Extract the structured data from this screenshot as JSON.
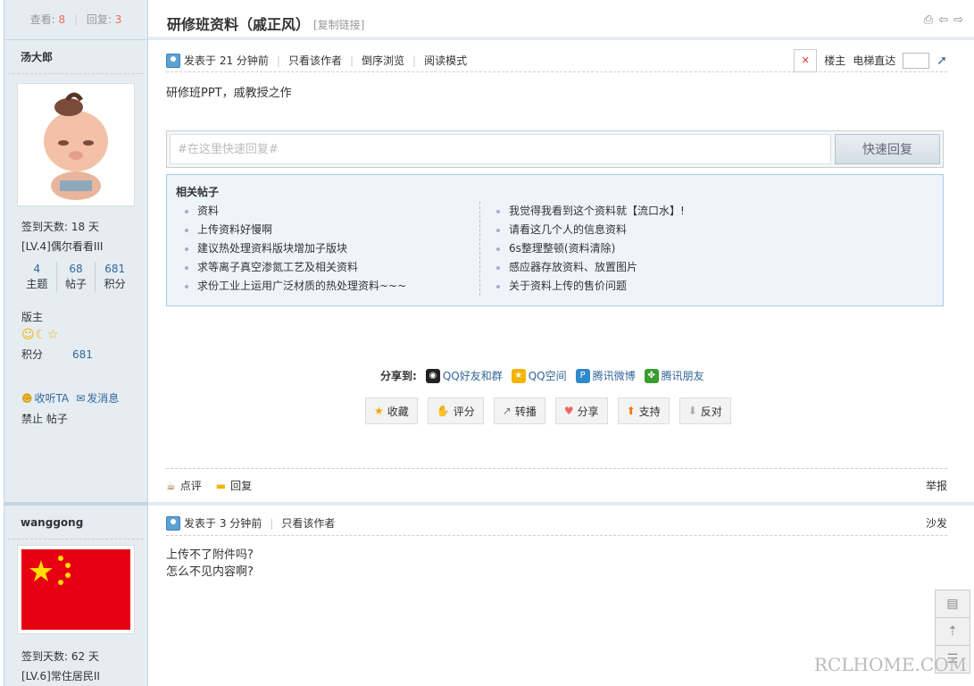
{
  "header": {
    "views_label": "查看:",
    "views_value": "8",
    "replies_label": "回复:",
    "replies_value": "3",
    "title": "研修班资料（戚正风）",
    "copy_link": "[复制链接]"
  },
  "post1": {
    "author": "汤大郎",
    "checkin": "签到天数: 18 天",
    "level": "[LV.4]偶尔看看III",
    "stats": [
      {
        "value": "4",
        "label": "主题"
      },
      {
        "value": "68",
        "label": "帖子"
      },
      {
        "value": "681",
        "label": "积分"
      }
    ],
    "role": "版主",
    "score_label": "积分",
    "score_value": "681",
    "follow": "收听TA",
    "message": "发消息",
    "ban": "禁止 帖子",
    "posted": "发表于 21 分钟前",
    "only_author": "只看该作者",
    "reverse": "倒序浏览",
    "read_mode": "阅读模式",
    "floor": "楼主",
    "elevator": "电梯直达",
    "body": "研修班PPT，戚教授之作",
    "quick_reply_placeholder": "#在这里快速回复#",
    "quick_reply_button": "快速回复",
    "related_title": "相关帖子",
    "related_left": [
      "资料",
      "上传资料好慢啊",
      "建议热处理资料版块增加子版块",
      "求等离子真空渗氮工艺及相关资料",
      "求份工业上运用广泛材质的热处理资料~~~"
    ],
    "related_right": [
      "我觉得我看到这个资料就【流口水】!",
      "请看这几个人的信息资料",
      "6s整理整顿(资料清除)",
      "感应器存放资料、放置图片",
      "关于资料上传的售价问题"
    ],
    "share_label": "分享到:",
    "share_items": [
      "QQ好友和群",
      "QQ空间",
      "腾讯微博",
      "腾讯朋友"
    ],
    "buttons": [
      "收藏",
      "评分",
      "转播",
      "分享",
      "支持",
      "反对"
    ],
    "comment": "点评",
    "reply": "回复",
    "report": "举报"
  },
  "post2": {
    "author": "wanggong",
    "checkin": "签到天数: 62 天",
    "level": "[LV.6]常住居民II",
    "posted": "发表于 3 分钟前",
    "only_author": "只看该作者",
    "floor": "沙发",
    "line1": "上传不了附件吗?",
    "line2": "怎么不见内容啊?"
  },
  "watermark": "RCLHOME.COM",
  "colors": {
    "accent": "#369",
    "count": "#f26c4f",
    "sidebar": "#e5edf2",
    "border": "#c2d5e3"
  }
}
